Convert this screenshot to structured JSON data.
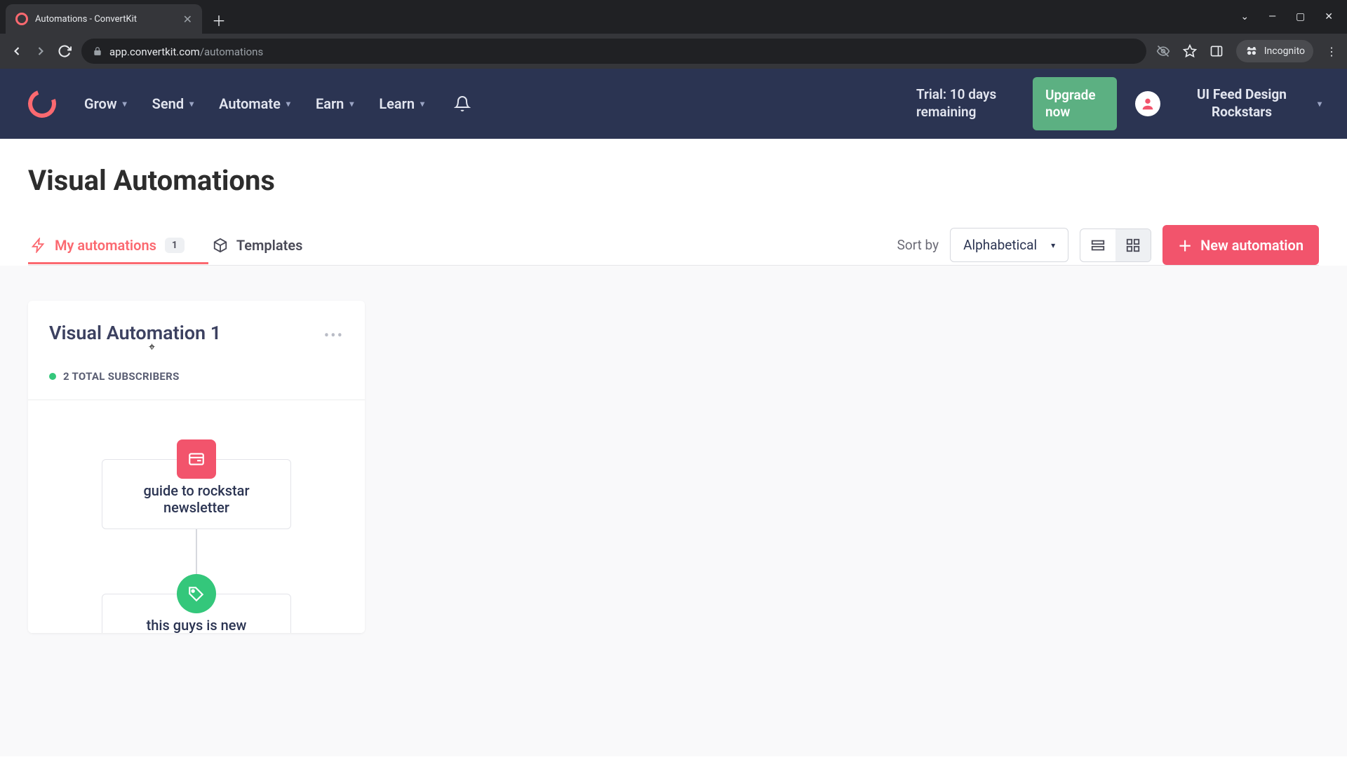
{
  "browser": {
    "tab_title": "Automations - ConvertKit",
    "url_host": "app.convertkit.com",
    "url_path": "/automations",
    "incognito_label": "Incognito"
  },
  "nav": {
    "items": [
      "Grow",
      "Send",
      "Automate",
      "Earn",
      "Learn"
    ],
    "trial_text": "Trial: 10 days remaining",
    "upgrade_label": "Upgrade now",
    "account_name": "UI Feed Design Rockstars"
  },
  "page": {
    "title": "Visual Automations"
  },
  "tabs": {
    "my_automations_label": "My automations",
    "my_automations_count": "1",
    "templates_label": "Templates"
  },
  "toolbar": {
    "sort_label": "Sort by",
    "sort_value": "Alphabetical",
    "new_label": "New automation"
  },
  "automation": {
    "title": "Visual Automation 1",
    "subscribers_text": "2 TOTAL SUBSCRIBERS",
    "node1_label": "guide to rockstar newsletter",
    "node2_label": "this guys is new"
  }
}
